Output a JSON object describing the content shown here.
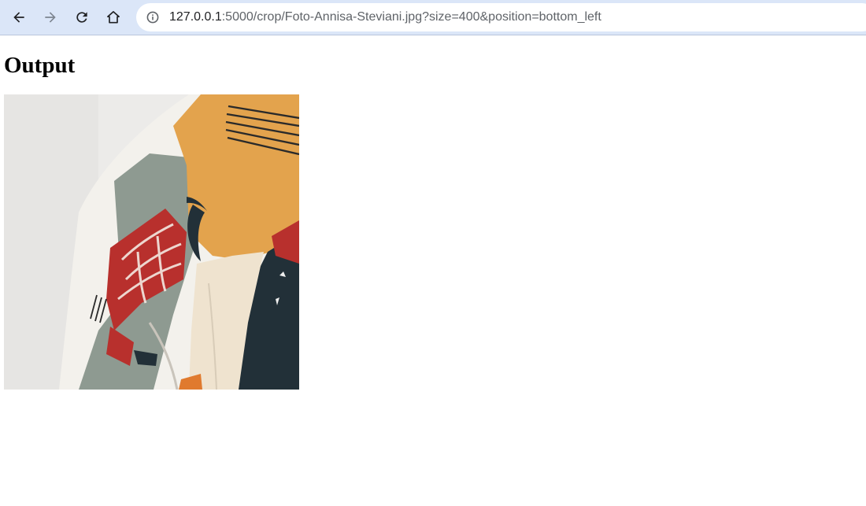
{
  "browser": {
    "url_host": "127.0.0.1",
    "url_rest": ":5000/crop/Foto-Annisa-Steviani.jpg?size=400&position=bottom_left",
    "icons": {
      "back": "arrow-left-icon",
      "forward": "arrow-right-icon",
      "reload": "reload-icon",
      "home": "home-icon",
      "info": "info-icon"
    }
  },
  "page": {
    "heading": "Output",
    "image_alt": "Foto-Annisa-Steviani.jpg"
  },
  "colors": {
    "toolbar_bg": "#dbe6f8",
    "omnibox_bg": "#ffffff",
    "wall": "#ecebe9",
    "mustard": "#e3a34d",
    "sage": "#8e9a91",
    "red": "#b8302d",
    "navy": "#223038",
    "cream": "#efe3cf"
  }
}
